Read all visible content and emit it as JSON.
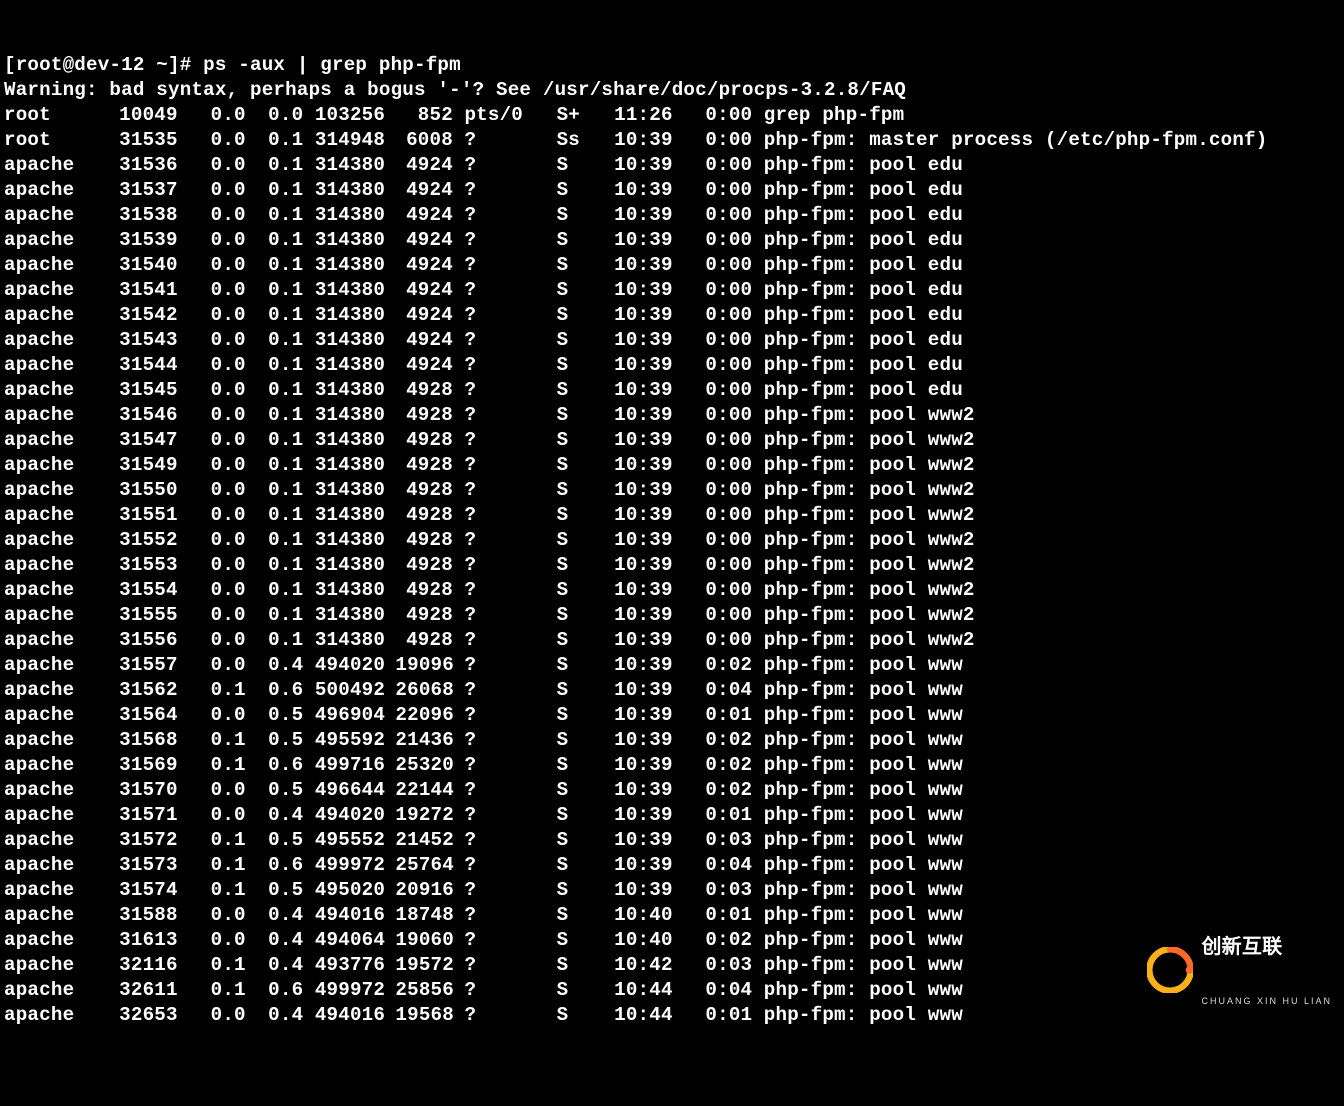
{
  "prompt_line": "[root@dev-12 ~]# ps -aux | grep php-fpm",
  "warning_line": "Warning: bad syntax, perhaps a bogus '-'? See /usr/share/doc/procps-3.2.8/FAQ",
  "rows": [
    {
      "user": "root",
      "pid": "10049",
      "cpu": "0.0",
      "mem": "0.0",
      "vsz": "103256",
      "rss": "852",
      "tty": "pts/0",
      "stat": "S+",
      "start": "11:26",
      "time": "0:00",
      "cmd": "grep php-fpm"
    },
    {
      "user": "root",
      "pid": "31535",
      "cpu": "0.0",
      "mem": "0.1",
      "vsz": "314948",
      "rss": "6008",
      "tty": "?",
      "stat": "Ss",
      "start": "10:39",
      "time": "0:00",
      "cmd": "php-fpm: master process (/etc/php-fpm.conf)"
    },
    {
      "user": "apache",
      "pid": "31536",
      "cpu": "0.0",
      "mem": "0.1",
      "vsz": "314380",
      "rss": "4924",
      "tty": "?",
      "stat": "S",
      "start": "10:39",
      "time": "0:00",
      "cmd": "php-fpm: pool edu"
    },
    {
      "user": "apache",
      "pid": "31537",
      "cpu": "0.0",
      "mem": "0.1",
      "vsz": "314380",
      "rss": "4924",
      "tty": "?",
      "stat": "S",
      "start": "10:39",
      "time": "0:00",
      "cmd": "php-fpm: pool edu"
    },
    {
      "user": "apache",
      "pid": "31538",
      "cpu": "0.0",
      "mem": "0.1",
      "vsz": "314380",
      "rss": "4924",
      "tty": "?",
      "stat": "S",
      "start": "10:39",
      "time": "0:00",
      "cmd": "php-fpm: pool edu"
    },
    {
      "user": "apache",
      "pid": "31539",
      "cpu": "0.0",
      "mem": "0.1",
      "vsz": "314380",
      "rss": "4924",
      "tty": "?",
      "stat": "S",
      "start": "10:39",
      "time": "0:00",
      "cmd": "php-fpm: pool edu"
    },
    {
      "user": "apache",
      "pid": "31540",
      "cpu": "0.0",
      "mem": "0.1",
      "vsz": "314380",
      "rss": "4924",
      "tty": "?",
      "stat": "S",
      "start": "10:39",
      "time": "0:00",
      "cmd": "php-fpm: pool edu"
    },
    {
      "user": "apache",
      "pid": "31541",
      "cpu": "0.0",
      "mem": "0.1",
      "vsz": "314380",
      "rss": "4924",
      "tty": "?",
      "stat": "S",
      "start": "10:39",
      "time": "0:00",
      "cmd": "php-fpm: pool edu"
    },
    {
      "user": "apache",
      "pid": "31542",
      "cpu": "0.0",
      "mem": "0.1",
      "vsz": "314380",
      "rss": "4924",
      "tty": "?",
      "stat": "S",
      "start": "10:39",
      "time": "0:00",
      "cmd": "php-fpm: pool edu"
    },
    {
      "user": "apache",
      "pid": "31543",
      "cpu": "0.0",
      "mem": "0.1",
      "vsz": "314380",
      "rss": "4924",
      "tty": "?",
      "stat": "S",
      "start": "10:39",
      "time": "0:00",
      "cmd": "php-fpm: pool edu"
    },
    {
      "user": "apache",
      "pid": "31544",
      "cpu": "0.0",
      "mem": "0.1",
      "vsz": "314380",
      "rss": "4924",
      "tty": "?",
      "stat": "S",
      "start": "10:39",
      "time": "0:00",
      "cmd": "php-fpm: pool edu"
    },
    {
      "user": "apache",
      "pid": "31545",
      "cpu": "0.0",
      "mem": "0.1",
      "vsz": "314380",
      "rss": "4928",
      "tty": "?",
      "stat": "S",
      "start": "10:39",
      "time": "0:00",
      "cmd": "php-fpm: pool edu"
    },
    {
      "user": "apache",
      "pid": "31546",
      "cpu": "0.0",
      "mem": "0.1",
      "vsz": "314380",
      "rss": "4928",
      "tty": "?",
      "stat": "S",
      "start": "10:39",
      "time": "0:00",
      "cmd": "php-fpm: pool www2"
    },
    {
      "user": "apache",
      "pid": "31547",
      "cpu": "0.0",
      "mem": "0.1",
      "vsz": "314380",
      "rss": "4928",
      "tty": "?",
      "stat": "S",
      "start": "10:39",
      "time": "0:00",
      "cmd": "php-fpm: pool www2"
    },
    {
      "user": "apache",
      "pid": "31549",
      "cpu": "0.0",
      "mem": "0.1",
      "vsz": "314380",
      "rss": "4928",
      "tty": "?",
      "stat": "S",
      "start": "10:39",
      "time": "0:00",
      "cmd": "php-fpm: pool www2"
    },
    {
      "user": "apache",
      "pid": "31550",
      "cpu": "0.0",
      "mem": "0.1",
      "vsz": "314380",
      "rss": "4928",
      "tty": "?",
      "stat": "S",
      "start": "10:39",
      "time": "0:00",
      "cmd": "php-fpm: pool www2"
    },
    {
      "user": "apache",
      "pid": "31551",
      "cpu": "0.0",
      "mem": "0.1",
      "vsz": "314380",
      "rss": "4928",
      "tty": "?",
      "stat": "S",
      "start": "10:39",
      "time": "0:00",
      "cmd": "php-fpm: pool www2"
    },
    {
      "user": "apache",
      "pid": "31552",
      "cpu": "0.0",
      "mem": "0.1",
      "vsz": "314380",
      "rss": "4928",
      "tty": "?",
      "stat": "S",
      "start": "10:39",
      "time": "0:00",
      "cmd": "php-fpm: pool www2"
    },
    {
      "user": "apache",
      "pid": "31553",
      "cpu": "0.0",
      "mem": "0.1",
      "vsz": "314380",
      "rss": "4928",
      "tty": "?",
      "stat": "S",
      "start": "10:39",
      "time": "0:00",
      "cmd": "php-fpm: pool www2"
    },
    {
      "user": "apache",
      "pid": "31554",
      "cpu": "0.0",
      "mem": "0.1",
      "vsz": "314380",
      "rss": "4928",
      "tty": "?",
      "stat": "S",
      "start": "10:39",
      "time": "0:00",
      "cmd": "php-fpm: pool www2"
    },
    {
      "user": "apache",
      "pid": "31555",
      "cpu": "0.0",
      "mem": "0.1",
      "vsz": "314380",
      "rss": "4928",
      "tty": "?",
      "stat": "S",
      "start": "10:39",
      "time": "0:00",
      "cmd": "php-fpm: pool www2"
    },
    {
      "user": "apache",
      "pid": "31556",
      "cpu": "0.0",
      "mem": "0.1",
      "vsz": "314380",
      "rss": "4928",
      "tty": "?",
      "stat": "S",
      "start": "10:39",
      "time": "0:00",
      "cmd": "php-fpm: pool www2"
    },
    {
      "user": "apache",
      "pid": "31557",
      "cpu": "0.0",
      "mem": "0.4",
      "vsz": "494020",
      "rss": "19096",
      "tty": "?",
      "stat": "S",
      "start": "10:39",
      "time": "0:02",
      "cmd": "php-fpm: pool www"
    },
    {
      "user": "apache",
      "pid": "31562",
      "cpu": "0.1",
      "mem": "0.6",
      "vsz": "500492",
      "rss": "26068",
      "tty": "?",
      "stat": "S",
      "start": "10:39",
      "time": "0:04",
      "cmd": "php-fpm: pool www"
    },
    {
      "user": "apache",
      "pid": "31564",
      "cpu": "0.0",
      "mem": "0.5",
      "vsz": "496904",
      "rss": "22096",
      "tty": "?",
      "stat": "S",
      "start": "10:39",
      "time": "0:01",
      "cmd": "php-fpm: pool www"
    },
    {
      "user": "apache",
      "pid": "31568",
      "cpu": "0.1",
      "mem": "0.5",
      "vsz": "495592",
      "rss": "21436",
      "tty": "?",
      "stat": "S",
      "start": "10:39",
      "time": "0:02",
      "cmd": "php-fpm: pool www"
    },
    {
      "user": "apache",
      "pid": "31569",
      "cpu": "0.1",
      "mem": "0.6",
      "vsz": "499716",
      "rss": "25320",
      "tty": "?",
      "stat": "S",
      "start": "10:39",
      "time": "0:02",
      "cmd": "php-fpm: pool www"
    },
    {
      "user": "apache",
      "pid": "31570",
      "cpu": "0.0",
      "mem": "0.5",
      "vsz": "496644",
      "rss": "22144",
      "tty": "?",
      "stat": "S",
      "start": "10:39",
      "time": "0:02",
      "cmd": "php-fpm: pool www"
    },
    {
      "user": "apache",
      "pid": "31571",
      "cpu": "0.0",
      "mem": "0.4",
      "vsz": "494020",
      "rss": "19272",
      "tty": "?",
      "stat": "S",
      "start": "10:39",
      "time": "0:01",
      "cmd": "php-fpm: pool www"
    },
    {
      "user": "apache",
      "pid": "31572",
      "cpu": "0.1",
      "mem": "0.5",
      "vsz": "495552",
      "rss": "21452",
      "tty": "?",
      "stat": "S",
      "start": "10:39",
      "time": "0:03",
      "cmd": "php-fpm: pool www"
    },
    {
      "user": "apache",
      "pid": "31573",
      "cpu": "0.1",
      "mem": "0.6",
      "vsz": "499972",
      "rss": "25764",
      "tty": "?",
      "stat": "S",
      "start": "10:39",
      "time": "0:04",
      "cmd": "php-fpm: pool www"
    },
    {
      "user": "apache",
      "pid": "31574",
      "cpu": "0.1",
      "mem": "0.5",
      "vsz": "495020",
      "rss": "20916",
      "tty": "?",
      "stat": "S",
      "start": "10:39",
      "time": "0:03",
      "cmd": "php-fpm: pool www"
    },
    {
      "user": "apache",
      "pid": "31588",
      "cpu": "0.0",
      "mem": "0.4",
      "vsz": "494016",
      "rss": "18748",
      "tty": "?",
      "stat": "S",
      "start": "10:40",
      "time": "0:01",
      "cmd": "php-fpm: pool www"
    },
    {
      "user": "apache",
      "pid": "31613",
      "cpu": "0.0",
      "mem": "0.4",
      "vsz": "494064",
      "rss": "19060",
      "tty": "?",
      "stat": "S",
      "start": "10:40",
      "time": "0:02",
      "cmd": "php-fpm: pool www"
    },
    {
      "user": "apache",
      "pid": "32116",
      "cpu": "0.1",
      "mem": "0.4",
      "vsz": "493776",
      "rss": "19572",
      "tty": "?",
      "stat": "S",
      "start": "10:42",
      "time": "0:03",
      "cmd": "php-fpm: pool www"
    },
    {
      "user": "apache",
      "pid": "32611",
      "cpu": "0.1",
      "mem": "0.6",
      "vsz": "499972",
      "rss": "25856",
      "tty": "?",
      "stat": "S",
      "start": "10:44",
      "time": "0:04",
      "cmd": "php-fpm: pool www"
    },
    {
      "user": "apache",
      "pid": "32653",
      "cpu": "0.0",
      "mem": "0.4",
      "vsz": "494016",
      "rss": "19568",
      "tty": "?",
      "stat": "S",
      "start": "10:44",
      "time": "0:01",
      "cmd": "php-fpm: pool www"
    }
  ],
  "watermark": {
    "cn": "创新互联",
    "en": "CHUANG XIN HU LIAN"
  }
}
